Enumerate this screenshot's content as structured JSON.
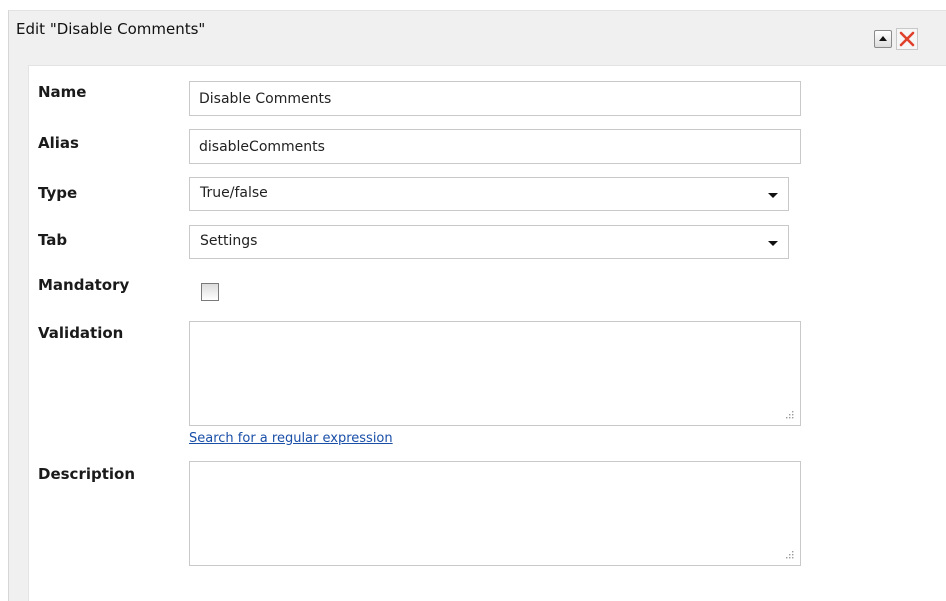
{
  "dialog": {
    "title": "Edit \"Disable Comments\"",
    "collapse_icon": "chevron-up-icon",
    "close_icon": "close-x-icon",
    "close_color": "#e0402a"
  },
  "form": {
    "name": {
      "label": "Name",
      "value": "Disable Comments"
    },
    "alias": {
      "label": "Alias",
      "value": "disableComments"
    },
    "type": {
      "label": "Type",
      "selected": "True/false"
    },
    "tab": {
      "label": "Tab",
      "selected": "Settings"
    },
    "mandatory": {
      "label": "Mandatory",
      "checked": false
    },
    "validation": {
      "label": "Validation",
      "value": "",
      "link": "Search for a regular expression"
    },
    "description": {
      "label": "Description",
      "value": ""
    }
  }
}
